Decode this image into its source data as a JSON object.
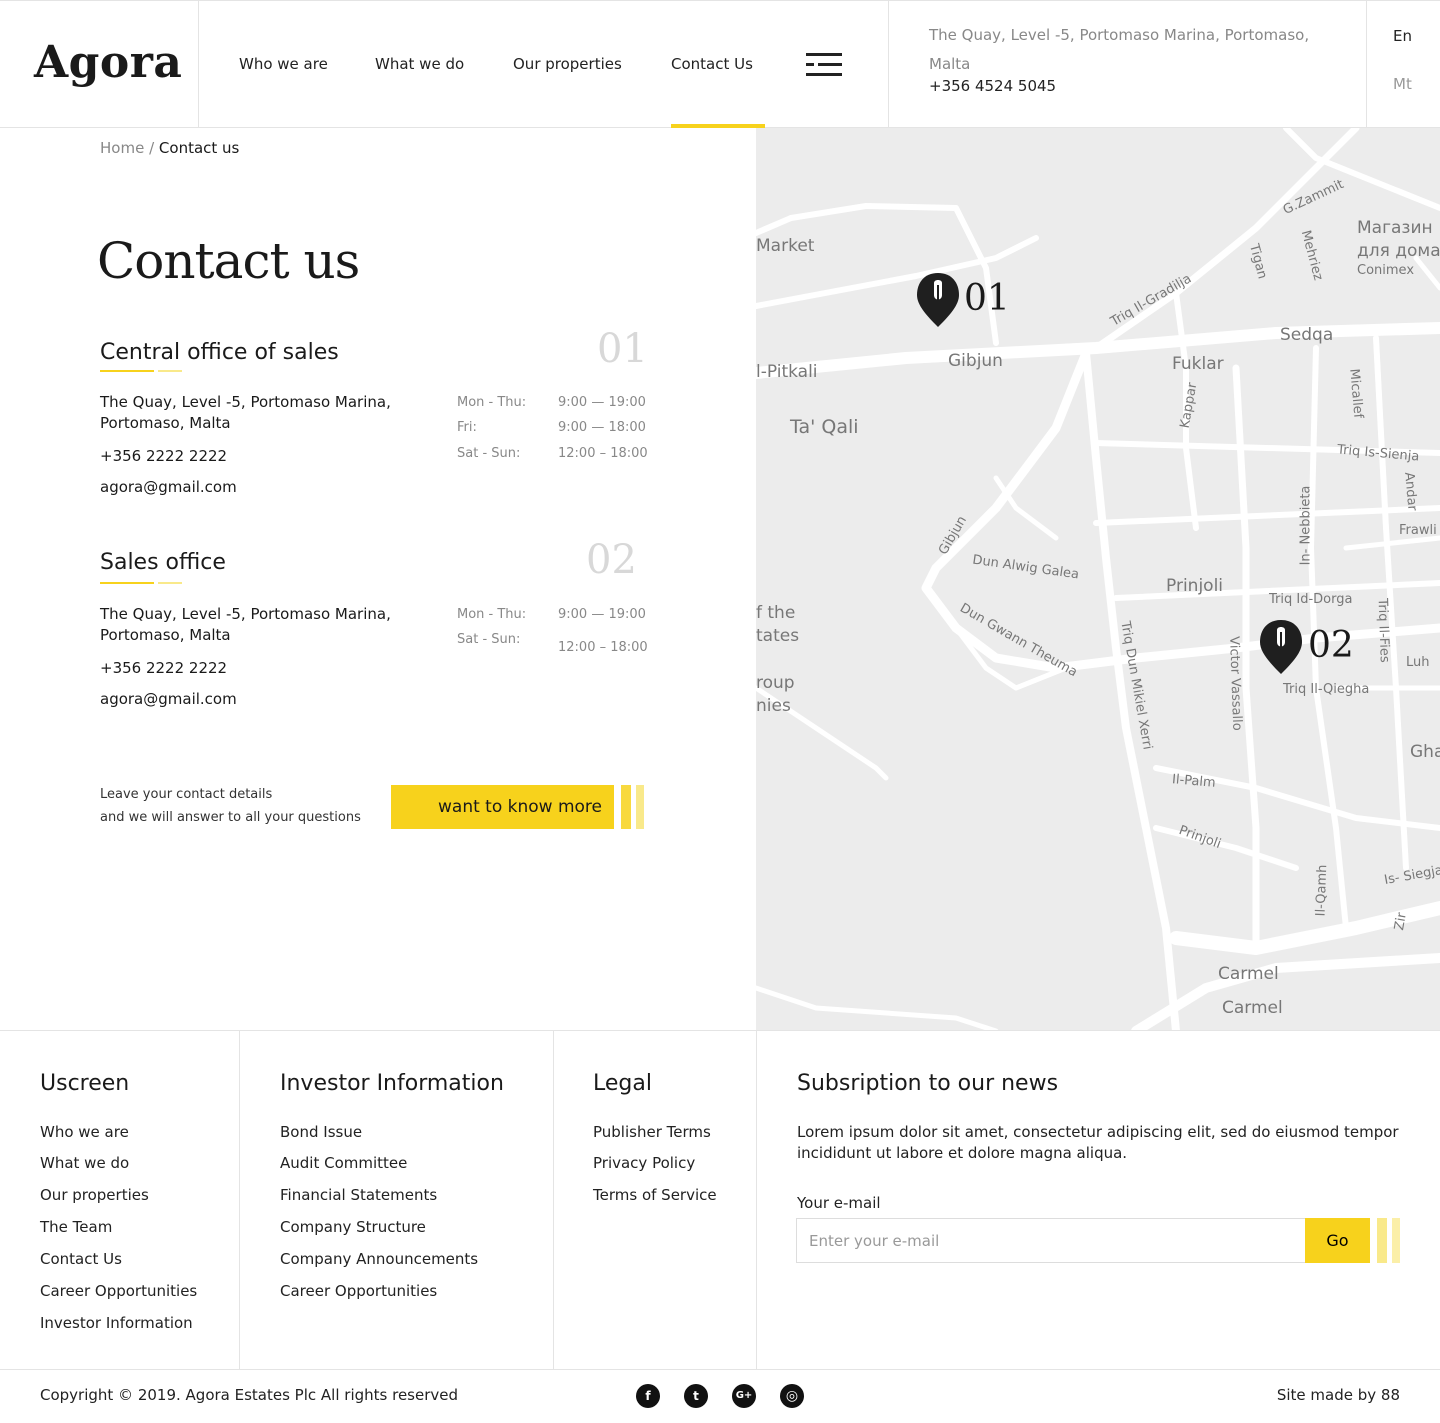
{
  "header": {
    "logo": "Agora",
    "nav": [
      "Who we are",
      "What we do",
      "Our properties",
      "Contact Us"
    ],
    "address": "The Quay, Level -5, Portomaso Marina, Portomaso, Malta",
    "phone": "+356 4524 5045",
    "languages": [
      "En",
      "Mt"
    ]
  },
  "breadcrumb": {
    "home": "Home",
    "separator": "/",
    "current": "Contact us"
  },
  "page_title": "Contact us",
  "offices": [
    {
      "title": "Central office of sales",
      "number": "01",
      "address": "The Quay, Level -5, Portomaso Marina, Portomaso, Malta",
      "phone": "+356 2222 2222",
      "email": "agora@gmail.com",
      "hours": [
        {
          "label": "Mon - Thu:",
          "value": "9:00 — 19:00"
        },
        {
          "label": "Fri:",
          "value": "9:00 — 18:00"
        },
        {
          "label": "Sat - Sun:",
          "value": "12:00 – 18:00"
        }
      ]
    },
    {
      "title": "Sales office",
      "number": "02",
      "address": "The Quay, Level -5, Portomaso Marina, Portomaso, Malta",
      "phone": "+356 2222 2222",
      "email": "agora@gmail.com",
      "hours": [
        {
          "label": "Mon - Thu:",
          "value": "9:00 — 19:00"
        },
        {
          "label": "Sat - Sun:",
          "value": "12:00 – 18:00"
        }
      ]
    }
  ],
  "cta": {
    "line1": "Leave your contact details",
    "line2": "and we will answer to all your questions",
    "button": "want to know more"
  },
  "map": {
    "pins": [
      "01",
      "02"
    ],
    "labels": [
      "Market",
      "l-Pitkali",
      "Gibjun",
      "Ta' Qali",
      "Fuklar",
      "Sedqa",
      "G.Zammit",
      "Tigan",
      "Mehriez",
      "Магазин",
      "для дома",
      "Conimex",
      "Triq Il-Gradilja",
      "Kappar",
      "Micallef",
      "Triq Is-Sienja",
      "Andar",
      "Frawli",
      "In- Nebbieta",
      "Gibjun",
      "Dun Alwig Galea",
      "Prinjoli",
      "Triq Id-Dorga",
      "Triq Il-Fies",
      "f the",
      "tates",
      "Dun Gwann Theuma",
      "Victor Vassallo",
      "Triq Il-Qiegha",
      "Luh",
      "roup",
      "nies",
      "Triq Dun Mikiel Xerri",
      "Ghari",
      "Il-Palm",
      "Prinjoli",
      "Il-Qamh",
      "Is- Siegja",
      "Zir",
      "Carmel",
      "Carmel"
    ]
  },
  "footer": {
    "col1": {
      "title": "Uscreen",
      "links": [
        "Who we are",
        "What we do",
        "Our properties",
        "The Team",
        "Contact Us",
        "Career Opportunities",
        "Investor Information"
      ]
    },
    "col2": {
      "title": "Investor Information",
      "links": [
        "Bond Issue",
        "Audit Committee",
        "Financial Statements",
        "Company Structure",
        "Company Announcements",
        "Career Opportunities"
      ]
    },
    "col3": {
      "title": "Legal",
      "links": [
        "Publisher Terms",
        "Privacy Policy",
        "Terms of Service"
      ]
    },
    "subscribe": {
      "title": "Subsription to our news",
      "text": "Lorem ipsum dolor sit amet, consectetur adipiscing elit, sed do eiusmod tempor incididunt ut labore et dolore magna aliqua.",
      "email_label": "Your e-mail",
      "placeholder": "Enter your e-mail",
      "button": "Go"
    }
  },
  "bottom": {
    "copyright": "Copyright © 2019. Agora Estates Plc All rights reserved",
    "made_by": "Site made by 88",
    "social": [
      {
        "icon": "facebook-icon",
        "glyph": "f"
      },
      {
        "icon": "twitter-icon",
        "glyph": "t"
      },
      {
        "icon": "google-plus-icon",
        "glyph": "G+"
      },
      {
        "icon": "instagram-icon",
        "glyph": "◎"
      }
    ]
  },
  "colors": {
    "accent": "#f7d21c",
    "accent_light": "#f9e98a",
    "map_bg": "#ececec"
  }
}
